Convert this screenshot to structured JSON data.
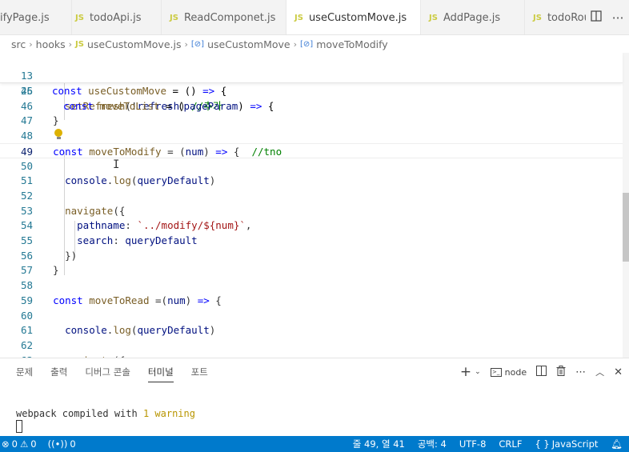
{
  "tabs": [
    {
      "label": "ifyPage.js",
      "has_js": false
    },
    {
      "label": "todoApi.js",
      "has_js": true
    },
    {
      "label": "ReadComponet.js",
      "has_js": true
    },
    {
      "label": "useCustomMove.js",
      "has_js": true,
      "active": true,
      "modified": true
    },
    {
      "label": "AddPage.js",
      "has_js": true
    },
    {
      "label": "todoRout",
      "has_js": true
    }
  ],
  "js_badge": "JS",
  "tab_actions": {
    "split": "split-editor",
    "more": "more-actions"
  },
  "breadcrumb": {
    "parts": [
      "src",
      "hooks",
      "useCustomMove.js",
      "useCustomMove",
      "moveToModify"
    ],
    "sym_badge": "[⊘]"
  },
  "editor": {
    "sticky": [
      {
        "ln": "13",
        "text_parts": [
          [
            "kw",
            "const "
          ],
          [
            "fn",
            "useCustomMove"
          ],
          [
            "pl",
            " = () "
          ],
          [
            "kw",
            "=>"
          ],
          [
            "pl",
            " {"
          ]
        ]
      },
      {
        "ln": "26",
        "text_parts": [
          [
            "pl",
            "  "
          ],
          [
            "kw",
            "const "
          ],
          [
            "fn",
            "moveToList"
          ],
          [
            "pl",
            " = ("
          ],
          [
            "var",
            "pageParam"
          ],
          [
            "pl",
            ") "
          ],
          [
            "kw",
            "=>"
          ],
          [
            "pl",
            " {"
          ]
        ]
      }
    ],
    "lines": [
      {
        "ln": "45",
        "text": ""
      },
      {
        "ln": "46",
        "text": "    setRefresh(!refresh) //추가"
      },
      {
        "ln": "47",
        "text": "  }"
      },
      {
        "ln": "48",
        "text": ""
      },
      {
        "ln": "49",
        "text": "  const moveToModify = (num) => {  //tno",
        "current": true
      },
      {
        "ln": "50",
        "text": ""
      },
      {
        "ln": "51",
        "text": "    console.log(queryDefault)"
      },
      {
        "ln": "52",
        "text": ""
      },
      {
        "ln": "53",
        "text": "    navigate({"
      },
      {
        "ln": "54",
        "text": "      pathname: `../modify/${num}`,"
      },
      {
        "ln": "55",
        "text": "      search: queryDefault"
      },
      {
        "ln": "56",
        "text": "    })"
      },
      {
        "ln": "57",
        "text": "  }"
      },
      {
        "ln": "58",
        "text": ""
      },
      {
        "ln": "59",
        "text": "  const moveToRead =(num) => {"
      },
      {
        "ln": "60",
        "text": ""
      },
      {
        "ln": "61",
        "text": "    console.log(queryDefault)"
      },
      {
        "ln": "62",
        "text": ""
      },
      {
        "ln": "63",
        "text": "    navigate({"
      }
    ]
  },
  "panel": {
    "tabs": [
      "문제",
      "출력",
      "디버그 콘솔",
      "터미널",
      "포트"
    ],
    "active_tab": "터미널",
    "node_label": "node",
    "terminal_text_plain": "webpack compiled with ",
    "terminal_text_warn": "1 warning"
  },
  "status": {
    "errors": "0",
    "warnings": "0",
    "ports": "0",
    "position": "줄 49, 열 41",
    "spaces": "공백: 4",
    "encoding": "UTF-8",
    "eol": "CRLF",
    "language": "JavaScript",
    "language_icon": "{ }"
  },
  "colors": {
    "accent": "#007acc",
    "keyword": "#0000ff",
    "function": "#795e26",
    "comment": "#008000",
    "string": "#a31515"
  }
}
